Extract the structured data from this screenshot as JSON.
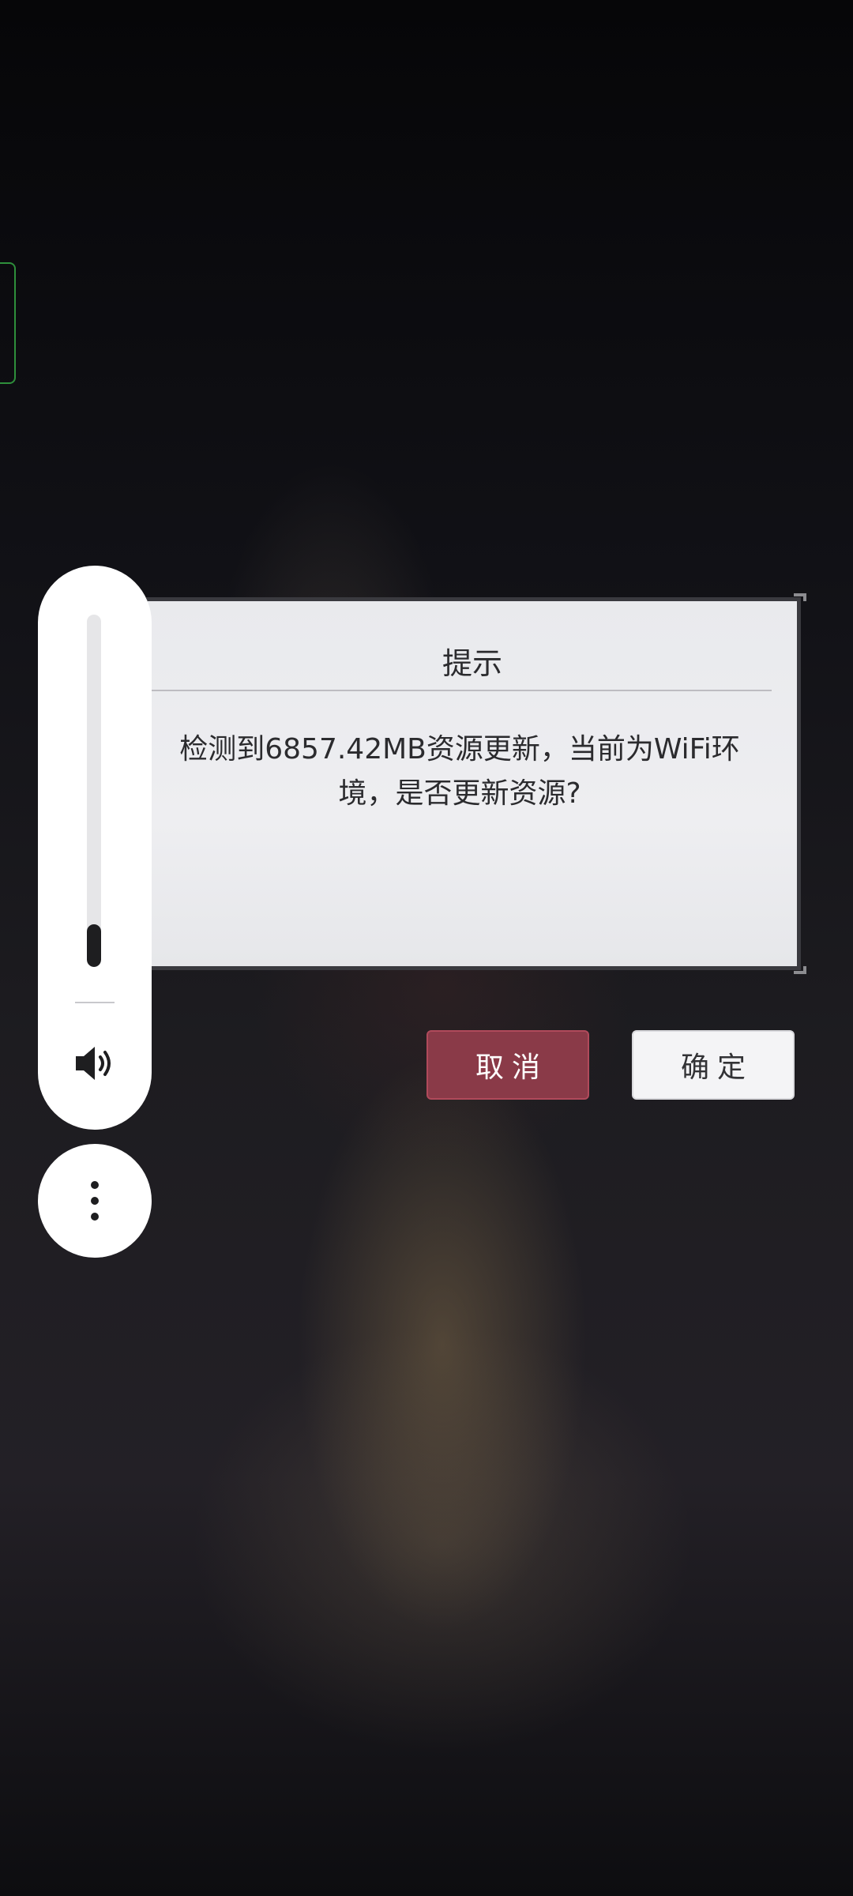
{
  "dialog": {
    "title": "提示",
    "message": "检测到6857.42MB资源更新，当前为WiFi环境，是否更新资源?",
    "cancel_label": "取消",
    "confirm_label": "确定"
  },
  "volume": {
    "level": 0.12,
    "icon": "speaker-icon"
  },
  "overlay": {
    "more_icon": "more-vertical-icon"
  },
  "colors": {
    "cancel_bg": "#8a3a48",
    "confirm_bg": "#f4f4f6",
    "dialog_bg": "#eeeef1"
  }
}
